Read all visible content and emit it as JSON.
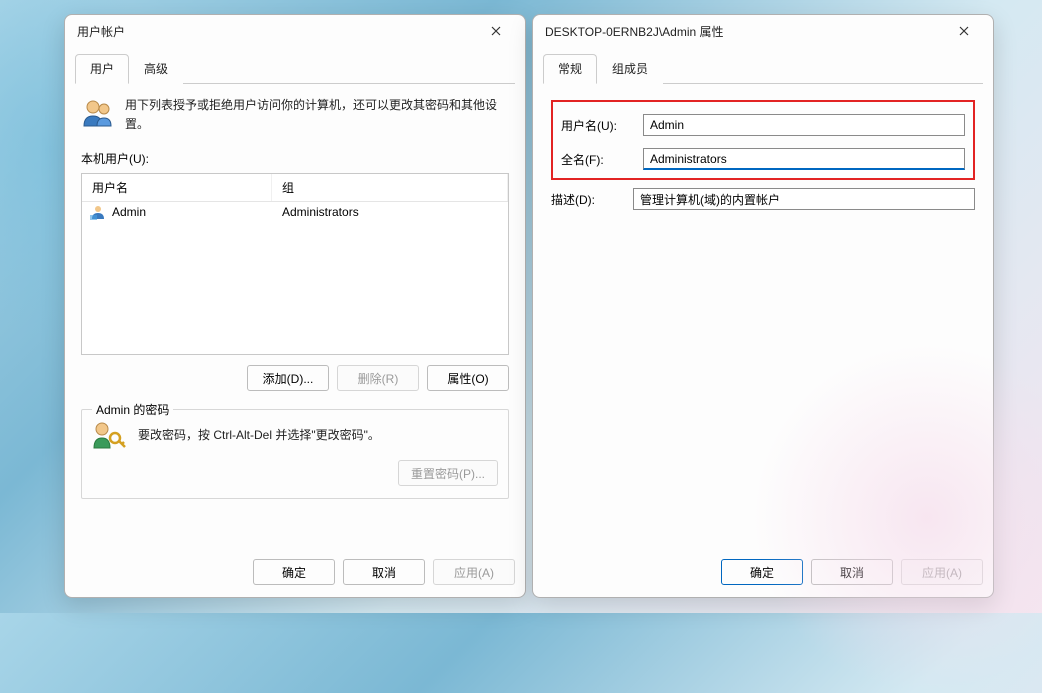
{
  "userAccounts": {
    "title": "用户帐户",
    "tabs": {
      "users": "用户",
      "advanced": "高级"
    },
    "intro": "用下列表授予或拒绝用户访问你的计算机，还可以更改其密码和其他设置。",
    "localUsersLabel": "本机用户(U):",
    "columns": {
      "name": "用户名",
      "group": "组"
    },
    "rows": [
      {
        "name": "Admin",
        "group": "Administrators"
      }
    ],
    "buttons": {
      "add": "添加(D)...",
      "remove": "删除(R)",
      "properties": "属性(O)"
    },
    "password": {
      "legend": "Admin 的密码",
      "hint": "要改密码，按 Ctrl-Alt-Del 并选择\"更改密码\"。",
      "reset": "重置密码(P)..."
    },
    "dialogButtons": {
      "ok": "确定",
      "cancel": "取消",
      "apply": "应用(A)"
    }
  },
  "properties": {
    "title": "DESKTOP-0ERNB2J\\Admin 属性",
    "tabs": {
      "general": "常规",
      "membership": "组成员"
    },
    "fields": {
      "usernameLabel": "用户名(U):",
      "usernameValue": "Admin",
      "fullnameLabel": "全名(F):",
      "fullnameValue": "Administrators",
      "descLabel": "描述(D):",
      "descValue": "管理计算机(域)的内置帐户"
    },
    "dialogButtons": {
      "ok": "确定",
      "cancel": "取消",
      "apply": "应用(A)"
    }
  }
}
